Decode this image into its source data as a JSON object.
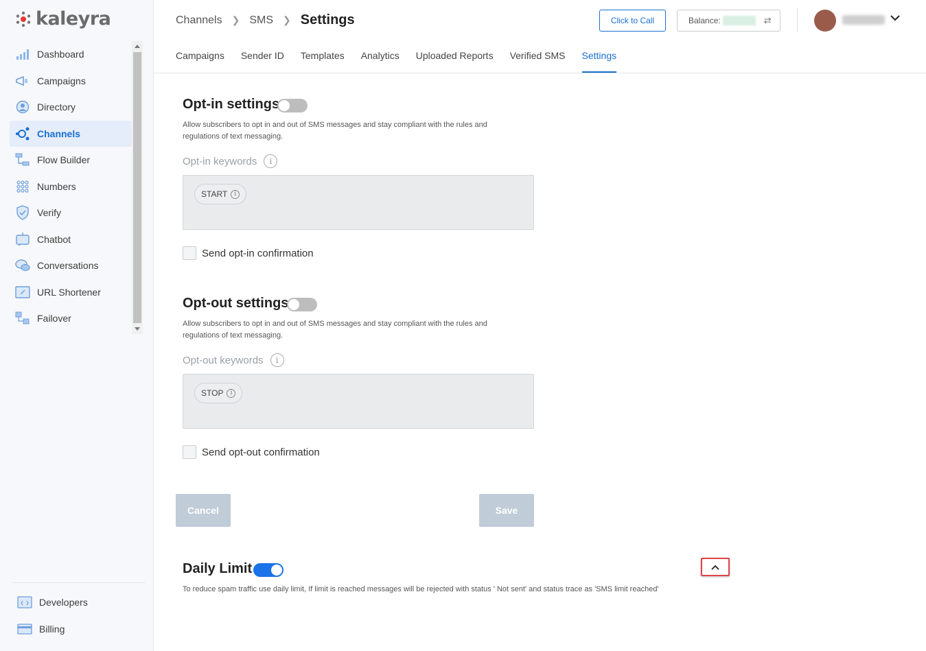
{
  "brand": {
    "name": "kaleyra"
  },
  "sidebar": {
    "items": [
      {
        "label": "Dashboard",
        "icon": "dashboard-icon"
      },
      {
        "label": "Campaigns",
        "icon": "megaphone-icon"
      },
      {
        "label": "Directory",
        "icon": "contact-icon"
      },
      {
        "label": "Channels",
        "icon": "channels-icon",
        "active": true
      },
      {
        "label": "Flow Builder",
        "icon": "flow-icon"
      },
      {
        "label": "Numbers",
        "icon": "dialpad-icon"
      },
      {
        "label": "Verify",
        "icon": "shield-icon"
      },
      {
        "label": "Chatbot",
        "icon": "chatbot-icon"
      },
      {
        "label": "Conversations",
        "icon": "chat-icon"
      },
      {
        "label": "URL Shortener",
        "icon": "link-icon"
      },
      {
        "label": "Failover",
        "icon": "failover-icon"
      }
    ],
    "bottom_items": [
      {
        "label": "Developers",
        "icon": "code-icon"
      },
      {
        "label": "Billing",
        "icon": "card-icon"
      }
    ]
  },
  "header": {
    "breadcrumb": [
      "Channels",
      "SMS",
      "Settings"
    ],
    "click_to_call": "Click to Call",
    "balance_label": "Balance:",
    "tabs": [
      "Campaigns",
      "Sender ID",
      "Templates",
      "Analytics",
      "Uploaded Reports",
      "Verified SMS",
      "Settings"
    ],
    "active_tab": "Settings"
  },
  "optin": {
    "title": "Opt-in settings",
    "enabled": false,
    "desc_line1": "Allow subscribers to opt in and out of SMS messages and stay compliant with the rules and",
    "desc_line2": "regulations of text messaging.",
    "keywords_label": "Opt-in keywords",
    "keyword": "START",
    "confirm_label": "Send opt-in confirmation"
  },
  "optout": {
    "title": "Opt-out settings",
    "enabled": false,
    "desc_line1": "Allow subscribers to opt in and out of SMS messages and stay compliant with the rules and",
    "desc_line2": "regulations of text messaging.",
    "keywords_label": "Opt-out keywords",
    "keyword": "STOP",
    "confirm_label": "Send opt-out confirmation"
  },
  "actions": {
    "cancel": "Cancel",
    "save": "Save"
  },
  "daily_limit": {
    "title": "Daily Limit",
    "enabled": true,
    "desc": "To reduce spam traffic use daily limit, If limit is reached messages will be rejected with status ' Not sent' and status trace as 'SMS limit reached'"
  },
  "colors": {
    "accent": "#1a6fd1",
    "toggle_on": "#1a73e8",
    "highlight": "#e04444"
  }
}
